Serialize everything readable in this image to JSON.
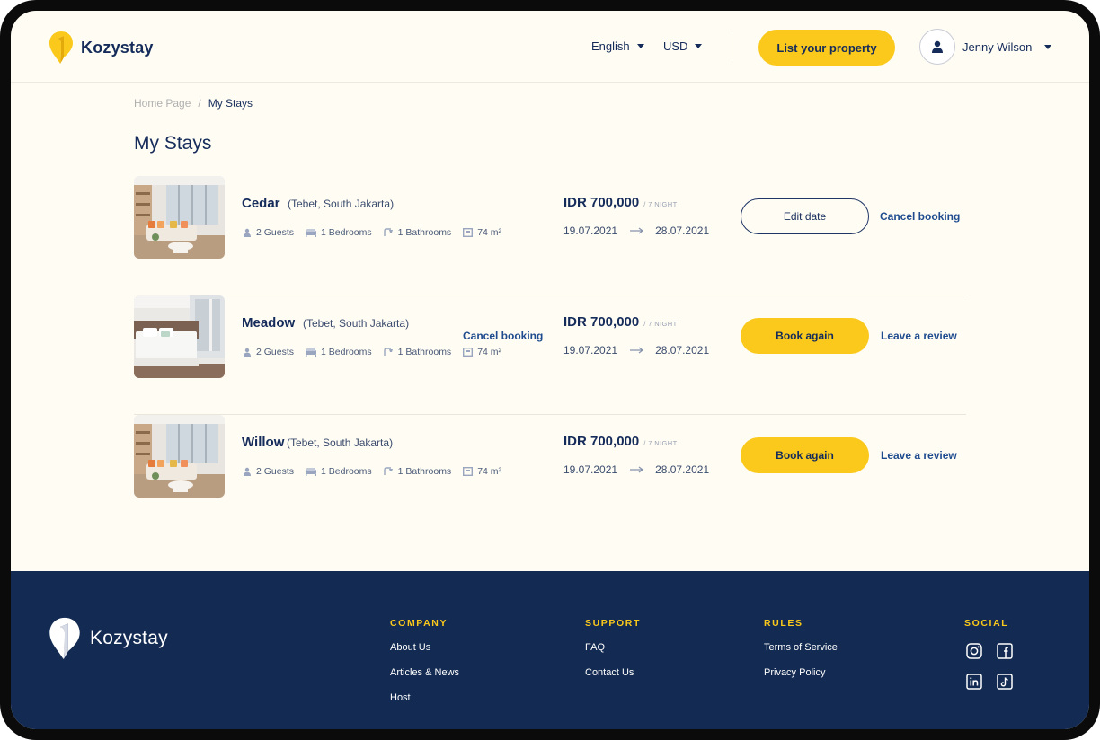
{
  "header": {
    "brand": "Kozystay",
    "language": "English",
    "currency": "USD",
    "cta": "List your property",
    "user_name": "Jenny Wilson"
  },
  "breadcrumb": {
    "home": "Home Page",
    "separator": "/",
    "current": "My Stays"
  },
  "page_title": "My Stays",
  "stays": [
    {
      "name": "Cedar",
      "location": "(Tebet, South Jakarta)",
      "guests": "2 Guests",
      "bedrooms": "1 Bedrooms",
      "bathrooms": "1 Bathrooms",
      "area": "74 m²",
      "price": "IDR 700,000",
      "price_unit": "/ 7 NIGHT",
      "check_in": "19.07.2021",
      "check_out": "28.07.2021",
      "primary_action": "Edit date",
      "secondary_action": "Cancel booking"
    },
    {
      "name": "Meadow",
      "location": "(Tebet, South Jakarta)",
      "guests": "2 Guests",
      "bedrooms": "1 Bedrooms",
      "bathrooms": "1 Bathrooms",
      "area": "74 m²",
      "extra_link": "Cancel booking",
      "price": "IDR 700,000",
      "price_unit": "/ 7 NIGHT",
      "check_in": "19.07.2021",
      "check_out": "28.07.2021",
      "primary_action": "Book again",
      "secondary_action": "Leave a review"
    },
    {
      "name": "Willow",
      "location": "(Tebet, South Jakarta)",
      "guests": "2 Guests",
      "bedrooms": "1 Bedrooms",
      "bathrooms": "1 Bathrooms",
      "area": "74 m²",
      "price": "IDR 700,000",
      "price_unit": "/ 7 NIGHT",
      "check_in": "19.07.2021",
      "check_out": "28.07.2021",
      "primary_action": "Book again",
      "secondary_action": "Leave a review"
    }
  ],
  "footer": {
    "brand": "Kozystay",
    "company": {
      "title": "COMPANY",
      "links": [
        "About Us",
        "Articles & News",
        "Host"
      ]
    },
    "support": {
      "title": "SUPPORT",
      "links": [
        "FAQ",
        "Contact Us"
      ]
    },
    "rules": {
      "title": "RULES",
      "links": [
        "Terms of Service",
        "Privacy Policy"
      ]
    },
    "social": {
      "title": "SOCIAL",
      "icons": [
        "instagram-icon",
        "facebook-icon",
        "linkedin-icon",
        "tiktok-icon"
      ]
    }
  },
  "colors": {
    "accent": "#fbc91b",
    "navy": "#152c5b",
    "footer_bg": "#132a52",
    "page_bg": "#fffcf3",
    "link": "#1f4c8f"
  }
}
